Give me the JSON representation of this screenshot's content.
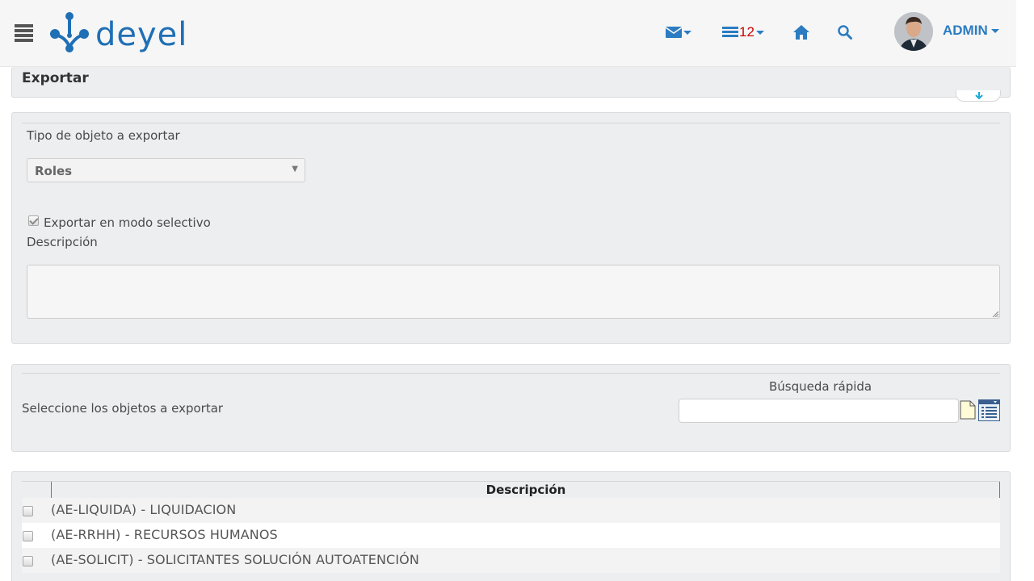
{
  "header": {
    "logo_text": "deyel",
    "notifications_count": "12",
    "user_name": "ADMIN"
  },
  "page": {
    "title": "Exportar"
  },
  "form": {
    "object_type_label": "Tipo de objeto a exportar",
    "object_type_value": "Roles",
    "selective_mode_label": "Exportar en modo selectivo",
    "selective_mode_checked": true,
    "description_label": "Descripción",
    "description_value": ""
  },
  "selection": {
    "prompt_label": "Seleccione los objetos a exportar",
    "quick_search_label": "Búsqueda rápida",
    "quick_search_value": ""
  },
  "table": {
    "column_header": "Descripción",
    "rows": [
      {
        "label": "(AE-LIQUIDA) - LIQUIDACION",
        "checked": false
      },
      {
        "label": "(AE-RRHH) - RECURSOS HUMANOS",
        "checked": false
      },
      {
        "label": "(AE-SOLICIT) - SOLICITANTES SOLUCIÓN AUTOATENCIÓN",
        "checked": false
      }
    ]
  },
  "colors": {
    "accent": "#2b7cc1",
    "badge": "#cc0000",
    "panel_bg": "#eceef0",
    "row_alt": "#f3f3f3"
  }
}
